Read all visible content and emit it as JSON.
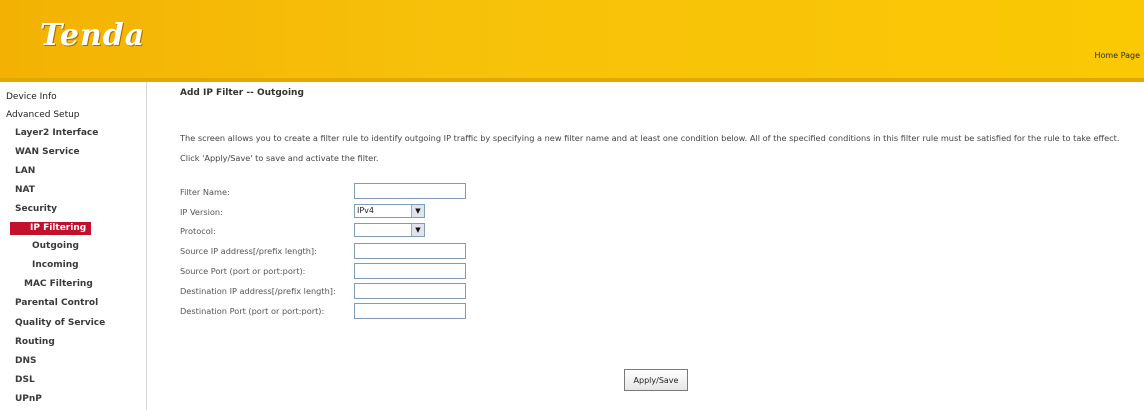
{
  "header": {
    "logo": "Tenda",
    "home_link": "Home Page"
  },
  "sidebar": {
    "items": [
      {
        "label": "Device Info"
      },
      {
        "label": "Advanced Setup"
      },
      {
        "label": "Layer2 Interface"
      },
      {
        "label": "WAN Service"
      },
      {
        "label": "LAN"
      },
      {
        "label": "NAT"
      },
      {
        "label": "Security"
      },
      {
        "label": "IP Filtering"
      },
      {
        "label": "Outgoing"
      },
      {
        "label": "Incoming"
      },
      {
        "label": "MAC Filtering"
      },
      {
        "label": "Parental Control"
      },
      {
        "label": "Quality of Service"
      },
      {
        "label": "Routing"
      },
      {
        "label": "DNS"
      },
      {
        "label": "DSL"
      },
      {
        "label": "UPnP"
      }
    ]
  },
  "main": {
    "title": "Add IP Filter -- Outgoing",
    "description": "The screen allows you to create a filter rule to identify outgoing IP traffic by specifying a new filter name and at least one condition below. All of the specified conditions in this filter rule must be satisfied for the rule to take effect. Click 'Apply/Save' to save and activate the filter.",
    "form": {
      "filter_name_label": "Filter Name:",
      "filter_name_value": "",
      "ip_version_label": "IP Version:",
      "ip_version_value": "IPv4",
      "protocol_label": "Protocol:",
      "protocol_value": "",
      "src_ip_label": "Source IP address[/prefix length]:",
      "src_ip_value": "",
      "src_port_label": "Source Port (port or port:port):",
      "src_port_value": "",
      "dst_ip_label": "Destination IP address[/prefix length]:",
      "dst_ip_value": "",
      "dst_port_label": "Destination Port (port or port:port):",
      "dst_port_value": ""
    },
    "apply_button": "Apply/Save"
  }
}
